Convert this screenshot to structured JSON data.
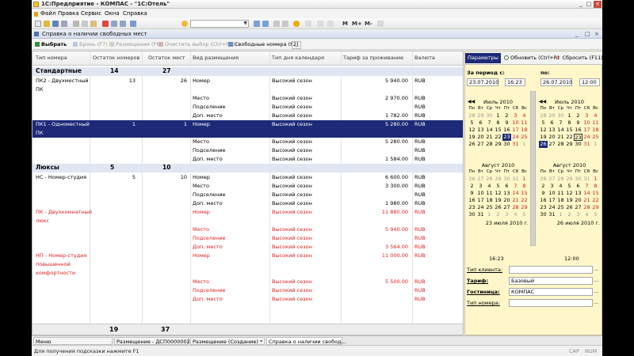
{
  "app": {
    "title": "1С:Предприятие - КОМПАС - \"1С:Отель\"",
    "window_buttons": [
      "_",
      "□",
      "×"
    ]
  },
  "menu": [
    "Файл",
    "Правка",
    "Сервис",
    "Окна",
    "Справка"
  ],
  "toolbar": {
    "select_placeholder": "",
    "font_size_icons": [
      "M",
      "M+",
      "M-"
    ]
  },
  "document": {
    "title": "Справка о наличии свободных мест",
    "buttons": [
      "_",
      "□",
      "×"
    ]
  },
  "commands": {
    "select": "Выбрать",
    "reserve": "Бронь (F7)",
    "accommodation": "Размещение (F6)",
    "clear": "Очистить выбор (Ctrl+F11)",
    "free_rooms": "Свободные номера (F2)",
    "more": "..."
  },
  "columns": [
    "Тип номера",
    "Остаток номеров",
    "Остаток мест",
    "Вид размещения",
    "Тип дня календаря",
    "Тариф за проживание",
    "Валюта"
  ],
  "rows": [
    {
      "kind": "group",
      "c0": "Стандартные",
      "c1": "14",
      "c2": "27"
    },
    {
      "kind": "item",
      "c0": "ПК2 - Двухместный",
      "c1": "13",
      "c2": "26",
      "c3": "Номер",
      "c4": "Высокий сезон",
      "c5": "5 940.00",
      "c6": "RUB"
    },
    {
      "kind": "cont",
      "c0": "ПК"
    },
    {
      "kind": "item",
      "c3": "Место",
      "c4": "Высокий сезон",
      "c5": "2 970.00",
      "c6": "RUB"
    },
    {
      "kind": "item",
      "c3": "Подселение",
      "c4": "Высокий сезон",
      "c5": "",
      "c6": "RUB"
    },
    {
      "kind": "item",
      "c3": "Доп. место",
      "c4": "Высокий сезон",
      "c5": "1 782.00",
      "c6": "RUB"
    },
    {
      "kind": "sel",
      "c0": "ПК1 - Одноместный",
      "c1": "1",
      "c2": "1",
      "c3": "Номер",
      "c4": "Высокий сезон",
      "c5": "5 280.00",
      "c6": "RUB"
    },
    {
      "kind": "selc",
      "c0": "ПК"
    },
    {
      "kind": "item",
      "c3": "Место",
      "c4": "Высокий сезон",
      "c5": "5 280.00",
      "c6": "RUB"
    },
    {
      "kind": "item",
      "c3": "Подселение",
      "c4": "Высокий сезон",
      "c5": "",
      "c6": "RUB"
    },
    {
      "kind": "item",
      "c3": "Доп. место",
      "c4": "Высокий сезон",
      "c5": "1 584.00",
      "c6": "RUB"
    },
    {
      "kind": "group",
      "c0": "Люксы",
      "c1": "5",
      "c2": "10"
    },
    {
      "kind": "item",
      "c0": "НС - Номер-студия",
      "c1": "5",
      "c2": "10",
      "c3": "Номер",
      "c4": "Высокий сезон",
      "c5": "6 600.00",
      "c6": "RUB"
    },
    {
      "kind": "item",
      "c3": "Место",
      "c4": "Высокий сезон",
      "c5": "3 300.00",
      "c6": "RUB"
    },
    {
      "kind": "item",
      "c3": "Подселение",
      "c4": "Высокий сезон",
      "c5": "",
      "c6": "RUB"
    },
    {
      "kind": "item",
      "c3": "Доп. место",
      "c4": "Высокий сезон",
      "c5": "1 980.00",
      "c6": "RUB"
    },
    {
      "kind": "red",
      "c0": "ПК - Двухкомнатный",
      "c3": "Номер",
      "c4": "Высокий сезон",
      "c5": "11 880.00",
      "c6": "RUB"
    },
    {
      "kind": "red",
      "c0": "люкс"
    },
    {
      "kind": "red",
      "c3": "Место",
      "c4": "Высокий сезон",
      "c5": "5 940.00",
      "c6": "RUB"
    },
    {
      "kind": "red",
      "c3": "Подселение",
      "c4": "Высокий сезон",
      "c5": "",
      "c6": "RUB"
    },
    {
      "kind": "red",
      "c3": "Доп. место",
      "c4": "Высокий сезон",
      "c5": "3 564.00",
      "c6": "RUB"
    },
    {
      "kind": "red",
      "c0": "НП - Номер-студия",
      "c3": "Номер",
      "c4": "Высокий сезон",
      "c5": "11 000.00",
      "c6": "RUB"
    },
    {
      "kind": "red",
      "c0": "повышенной"
    },
    {
      "kind": "red",
      "c0": "комфортности"
    },
    {
      "kind": "red",
      "c3": "Место",
      "c4": "Высокий сезон",
      "c5": "5 500.00",
      "c6": "RUB"
    },
    {
      "kind": "red",
      "c3": "Подселение",
      "c4": "Высокий сезон",
      "c5": "",
      "c6": "RUB"
    },
    {
      "kind": "red",
      "c3": "Доп. место",
      "c4": "Высокий сезон",
      "c5": "",
      "c6": "RUB"
    }
  ],
  "totals": {
    "rooms": "19",
    "places": "37"
  },
  "side": {
    "tab_params": "Параметры",
    "tab_refresh": "Обновить (Ctrl+R)",
    "tab_reset": "Сбросить (F11)",
    "period_label": "За период с:",
    "to_label": "по:",
    "date_from": "23.07.2010",
    "time_from": "16:23",
    "date_to": "26.07.2010",
    "time_to": "12:00",
    "client_type_label": "Тип клиента:",
    "client_type": "",
    "tariff_label": "Тариф:",
    "tariff": "Базовый",
    "hotel_label": "Гостиница:",
    "hotel": "КОМПАС",
    "room_type_label": "Тип номера:",
    "room_type": "",
    "time_left": "16:23",
    "time_right": "12:00",
    "cal_left_footer": "23 июля 2010 г.",
    "cal_right_footer": "26 июля 2010 г.",
    "month_july": "Июль 2010",
    "month_august": "Август 2010",
    "weekdays": [
      "Пн",
      "Вт",
      "Ср",
      "Чт",
      "Пт",
      "Сб",
      "Вс"
    ]
  },
  "taskbar": [
    "Меню",
    "Размещение - ДСП0000002...",
    "Размещение (Создание) *",
    "Справка о наличии свобод..."
  ],
  "status": {
    "hint": "Для получения подсказки нажмите F1",
    "cap": "CAP",
    "num": "NUM"
  }
}
